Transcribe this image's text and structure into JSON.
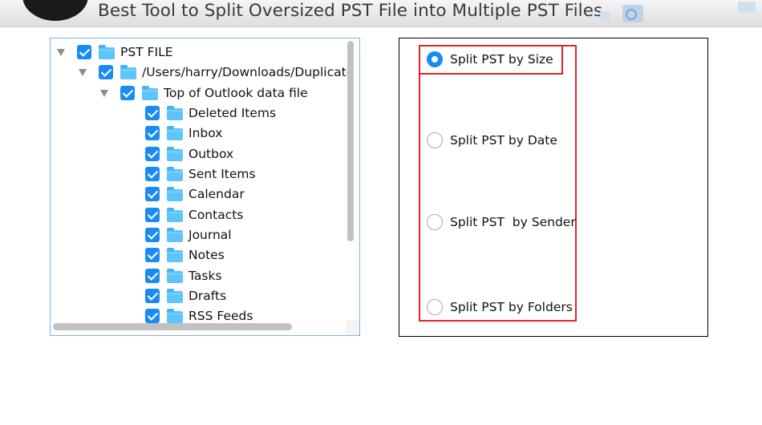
{
  "header": {
    "title": "Best Tool to Split Oversized PST File into Multiple PST Files"
  },
  "tree": {
    "items": [
      {
        "label": "PST FILE",
        "level": 0,
        "checked": true,
        "expanded": true
      },
      {
        "label": "/Users/harry/Downloads/Duplicate",
        "level": 1,
        "checked": true,
        "expanded": true
      },
      {
        "label": "Top of Outlook data file",
        "level": 2,
        "checked": true,
        "expanded": true
      },
      {
        "label": "Deleted Items",
        "level": 3,
        "checked": true
      },
      {
        "label": "Inbox",
        "level": 3,
        "checked": true
      },
      {
        "label": "Outbox",
        "level": 3,
        "checked": true
      },
      {
        "label": "Sent Items",
        "level": 3,
        "checked": true
      },
      {
        "label": "Calendar",
        "level": 3,
        "checked": true
      },
      {
        "label": "Contacts",
        "level": 3,
        "checked": true
      },
      {
        "label": "Journal",
        "level": 3,
        "checked": true
      },
      {
        "label": "Notes",
        "level": 3,
        "checked": true
      },
      {
        "label": "Tasks",
        "level": 3,
        "checked": true
      },
      {
        "label": "Drafts",
        "level": 3,
        "checked": true
      },
      {
        "label": "RSS Feeds",
        "level": 3,
        "checked": true
      }
    ]
  },
  "split_options": {
    "items": [
      {
        "label": "Split PST by Size",
        "selected": true
      },
      {
        "label": "Split PST by Date",
        "selected": false
      },
      {
        "label": "Split PST  by Sender",
        "selected": false
      },
      {
        "label": "Split PST by Folders",
        "selected": false
      }
    ]
  },
  "colors": {
    "accent": "#1a8bf3",
    "highlight_border": "#e0242a",
    "folder": "#5ec4fb",
    "tree_border": "#7fb4e3"
  },
  "icons": {
    "folder": "folder-icon",
    "expander": "triangle-down-icon",
    "logo": "app-logo-icon",
    "outlook": "outlook-icon"
  }
}
